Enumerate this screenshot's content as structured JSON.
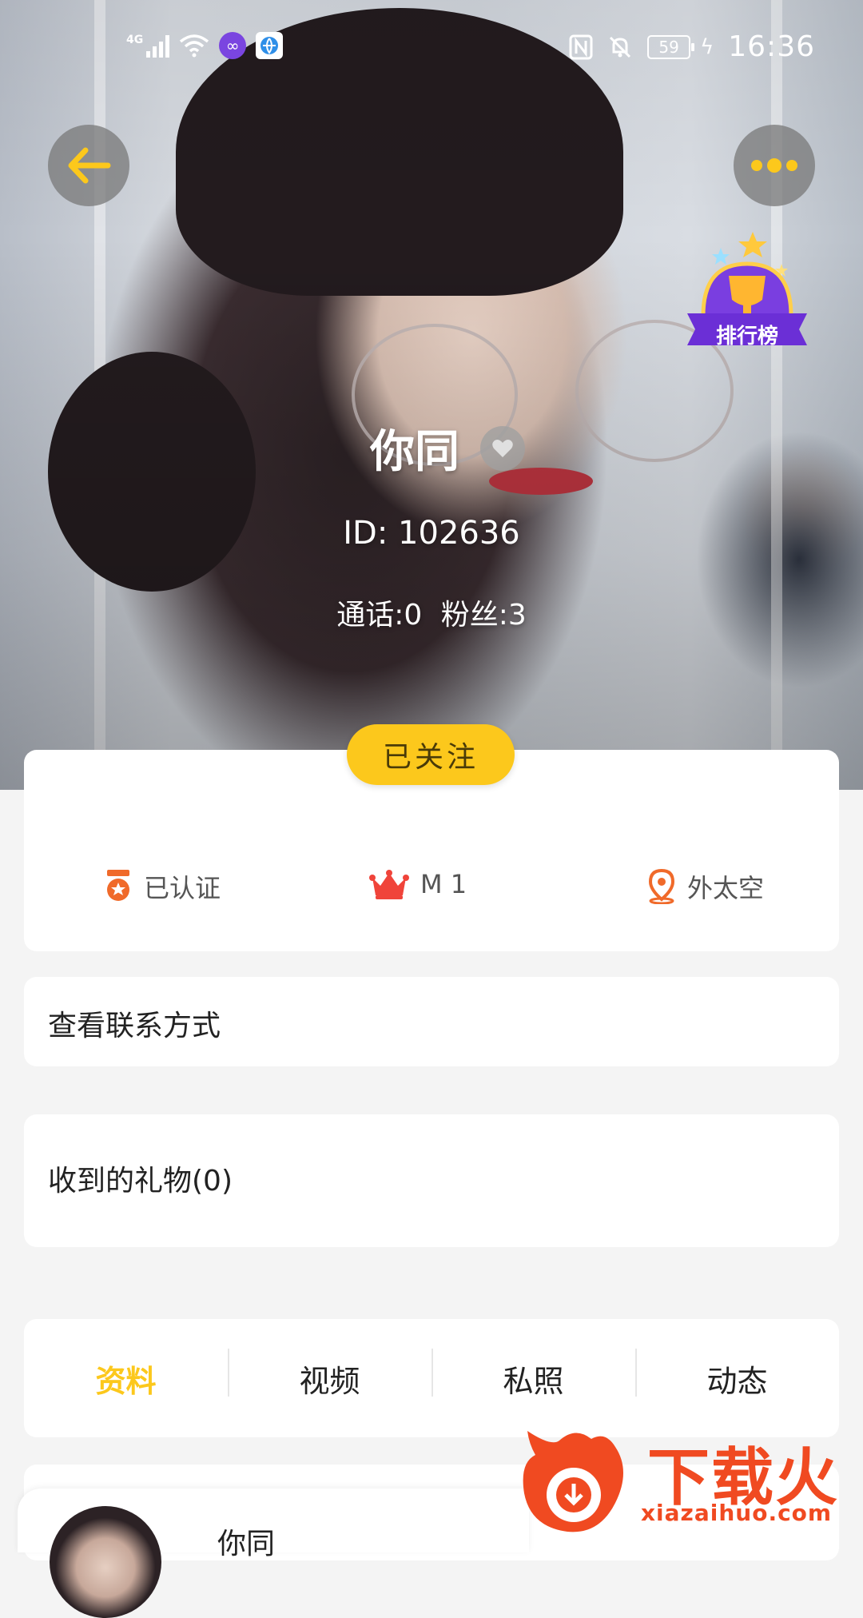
{
  "status_bar": {
    "network": "4G",
    "battery": "59",
    "time": "16:36"
  },
  "profile": {
    "name": "你同",
    "id_text": "ID: 102636",
    "calls_text": "通话:0",
    "fans_text": "粉丝:3",
    "rank_badge_label": "排行榜"
  },
  "follow_button": {
    "label": "已关注"
  },
  "tags": {
    "verified": "已认证",
    "level": "M 1",
    "location": "外太空"
  },
  "contact": {
    "label": "查看联系方式"
  },
  "gifts": {
    "label": "收到的礼物(0)"
  },
  "tabs": [
    {
      "label": "资料",
      "active": true
    },
    {
      "label": "视频",
      "active": false
    },
    {
      "label": "私照",
      "active": false
    },
    {
      "label": "动态",
      "active": false
    }
  ],
  "bottom_preview": {
    "name": "你同"
  },
  "watermark": {
    "text": "下载火",
    "url": "xiazaihuo.com"
  },
  "colors": {
    "accent": "#fcc81c",
    "tag_orange": "#f06a2a",
    "crown_red": "#f0443a",
    "badge_purple": "#6b3fd6"
  },
  "icons": [
    "back-arrow-icon",
    "more-dots-icon",
    "trophy-icon",
    "heart-icon",
    "medal-icon",
    "crown-icon",
    "location-pin-icon"
  ]
}
